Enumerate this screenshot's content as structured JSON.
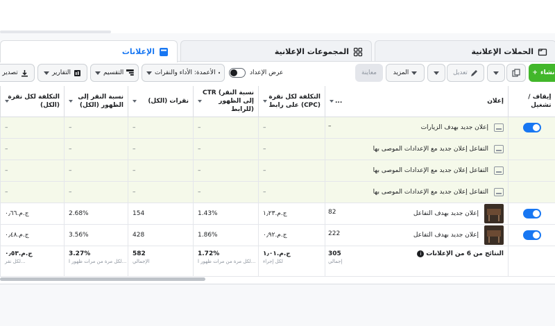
{
  "tabs": {
    "campaigns": "الحملات الإعلانية",
    "adsets": "المجموعات الإعلانية",
    "ads": "الإعلانات"
  },
  "toolbar": {
    "create": "إنشاء",
    "edit": "تعديل",
    "more": "المزيد",
    "preview": "معاينة",
    "view_setup": "عرض الإعداد",
    "columns": "الأعمدة: الأداء والنقرات",
    "breakdown": "التقسيم",
    "reports": "التقارير",
    "export": "تصدير"
  },
  "columns": {
    "toggle": "إيقاف / تشغيل",
    "ad": "إعلان",
    "cut": "...",
    "cpc": "التكلفة لكل نقرة على رابط (CPC)",
    "ctr": "CTR (نسبة النقر إلى الظهور للرابط)",
    "clicks": "نقرات (الكل)",
    "ctr_all": "نسبة النقر إلى الظهور (الكل)",
    "cost_all": "التكلفة لكل نقرة (الكل)"
  },
  "rows": [
    {
      "name": "إعلان جديد بهدف الزيارات",
      "type": "draft",
      "toggle": true,
      "results": "–",
      "cpc": "–",
      "ctr": "–",
      "clicks": "–",
      "ctr_all": "–",
      "cost_all": "–"
    },
    {
      "name": "التفاعل إعلان جديد مع الإعدادات الموصى بها",
      "type": "draft",
      "toggle": false,
      "results": "",
      "cpc": "–",
      "ctr": "–",
      "clicks": "–",
      "ctr_all": "–",
      "cost_all": "–"
    },
    {
      "name": "التفاعل إعلان جديد مع الإعدادات الموصى بها",
      "type": "draft",
      "toggle": false,
      "results": "",
      "cpc": "–",
      "ctr": "–",
      "clicks": "–",
      "ctr_all": "–",
      "cost_all": "–"
    },
    {
      "name": "التفاعل إعلان جديد مع الإعدادات الموصى بها",
      "type": "draft",
      "toggle": false,
      "results": "",
      "cpc": "–",
      "ctr": "–",
      "clicks": "–",
      "ctr_all": "–",
      "cost_all": "–"
    },
    {
      "name": "إعلان جديد بهدف التفاعل",
      "type": "active",
      "toggle": true,
      "results": "82",
      "cpc": "ج.م.١٫٢٣",
      "ctr": "1.43%",
      "clicks": "154",
      "ctr_all": "2.68%",
      "cost_all": "ج.م.٠٫٦٦"
    },
    {
      "name": "إعلان جديد بهدف التفاعل",
      "type": "active",
      "toggle": true,
      "results": "222",
      "cpc": "ج.م.٠٫٩٢",
      "ctr": "1.86%",
      "clicks": "428",
      "ctr_all": "3.56%",
      "cost_all": "ج.م.٠٫٤٨"
    }
  ],
  "totals": {
    "label": "النتائج من 6 من الإعلانات",
    "results": "305",
    "results_sub": "إجمالي",
    "cpc": "ج.م.١٫٠١",
    "cpc_sub": "لكل إجراء",
    "ctr": "1.72%",
    "ctr_sub": "لكل مرة من مرات ظهور ا...",
    "clicks": "582",
    "clicks_sub": "الإجمالي",
    "ctr_all": "3.27%",
    "ctr_all_sub": "لكل مرة من مرات ظهور ا...",
    "cost_all": "ج.م.٠٫٥٣",
    "cost_all_sub": "لكل نقر..."
  },
  "colors": {
    "accent": "#1877f2",
    "create_green": "#42b72a",
    "draft_row": "#f5f9ea"
  }
}
